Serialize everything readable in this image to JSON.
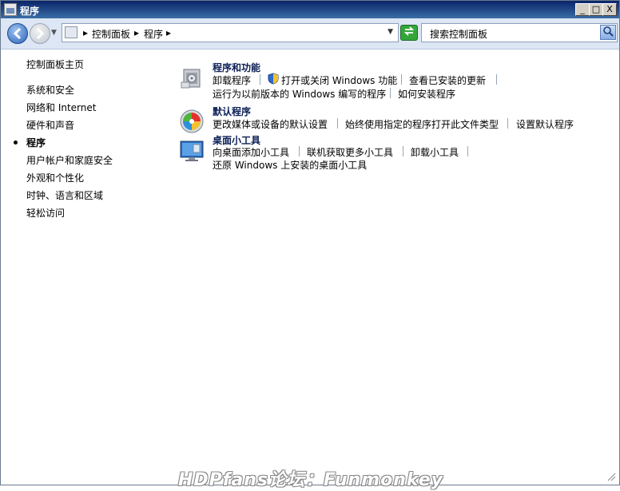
{
  "window": {
    "title": "程序"
  },
  "window_controls": {
    "minimize": "_",
    "maximize": "□",
    "close": "X"
  },
  "address": {
    "crumbs": [
      "控制面板",
      "程序"
    ],
    "separator": "▸"
  },
  "search": {
    "placeholder": "搜索控制面板"
  },
  "sidebar": {
    "home": "控制面板主页",
    "items": [
      {
        "label": "系统和安全"
      },
      {
        "label": "网络和 Internet"
      },
      {
        "label": "硬件和声音"
      },
      {
        "label": "程序",
        "selected": true
      },
      {
        "label": "用户帐户和家庭安全"
      },
      {
        "label": "外观和个性化"
      },
      {
        "label": "时钟、语言和区域"
      },
      {
        "label": "轻松访问"
      }
    ]
  },
  "categories": [
    {
      "title": "程序和功能",
      "icon": "programs-features-icon",
      "links": [
        "卸载程序",
        "打开或关闭 Windows 功能",
        "查看已安装的更新",
        "运行为以前版本的 Windows 编写的程序",
        "如何安装程序"
      ]
    },
    {
      "title": "默认程序",
      "icon": "default-programs-icon",
      "links": [
        "更改媒体或设备的默认设置",
        "始终使用指定的程序打开此文件类型",
        "设置默认程序"
      ]
    },
    {
      "title": "桌面小工具",
      "icon": "desktop-gadgets-icon",
      "links": [
        "向桌面添加小工具",
        "联机获取更多小工具",
        "卸载小工具",
        "还原 Windows 上安装的桌面小工具"
      ]
    }
  ],
  "watermark": "HDPfans论坛：Funmonkey"
}
